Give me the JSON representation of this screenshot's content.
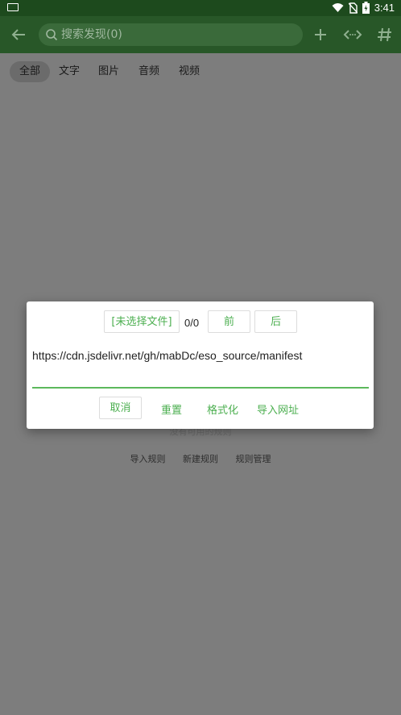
{
  "status_bar": {
    "time": "3:41"
  },
  "app_bar": {
    "search_placeholder": "搜索发现(0)"
  },
  "tabs": [
    {
      "label": "全部",
      "active": true
    },
    {
      "label": "文字",
      "active": false
    },
    {
      "label": "图片",
      "active": false
    },
    {
      "label": "音频",
      "active": false
    },
    {
      "label": "视频",
      "active": false
    }
  ],
  "empty_state": {
    "message": "没有可用的规则",
    "links": [
      "导入规则",
      "新建规则",
      "规则管理"
    ]
  },
  "dialog": {
    "choose_file_label": "[未选择文件]",
    "counter": "0/0",
    "prev_label": "前",
    "next_label": "后",
    "url_value": "https://cdn.jsdelivr.net/gh/mabDc/eso_source/manifest",
    "cancel_label": "取消",
    "reset_label": "重置",
    "format_label": "格式化",
    "import_url_label": "导入网址"
  },
  "colors": {
    "app_bar": "#285728",
    "status_bar": "#1d4a1d",
    "accent": "#4caf50",
    "scrim_background": "#7d7d7d"
  }
}
